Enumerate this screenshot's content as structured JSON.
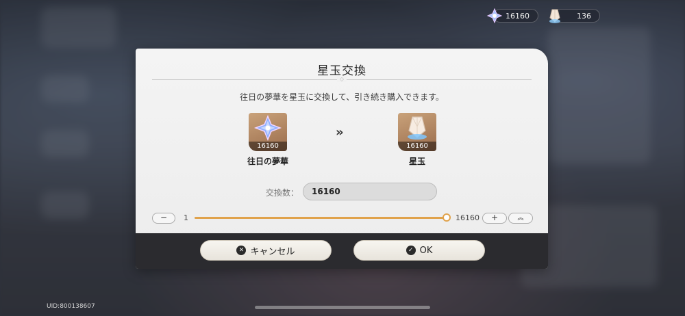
{
  "currencies": {
    "dream": {
      "value": "16160",
      "icon": "dream-flower-icon"
    },
    "gem": {
      "value": "136",
      "icon": "star-jade-icon"
    }
  },
  "dialog": {
    "title": "星玉交換",
    "description": "往日の夢華を星玉に交換して、引き続き購入できます。",
    "from_item": {
      "count": "16160",
      "name": "往日の夢華",
      "icon": "dream-flower-icon"
    },
    "to_item": {
      "count": "16160",
      "name": "星玉",
      "icon": "star-jade-icon"
    },
    "arrow": "»",
    "quantity_label": "交換数：",
    "quantity_value": "16160",
    "slider": {
      "min": "1",
      "max": "16160",
      "value": 16160,
      "fraction": 1.0
    },
    "minus_label": "−",
    "plus_label": "+",
    "max_label": "︽"
  },
  "buttons": {
    "cancel": {
      "label": "キャンセル",
      "icon": "x-circle-icon",
      "glyph": "✕"
    },
    "ok": {
      "label": "OK",
      "icon": "check-circle-icon",
      "glyph": "✓"
    }
  },
  "uid": "UID:800138607",
  "colors": {
    "accent": "#e0a24b",
    "footer": "#2b2b2f",
    "item_bg": "#b08460"
  }
}
